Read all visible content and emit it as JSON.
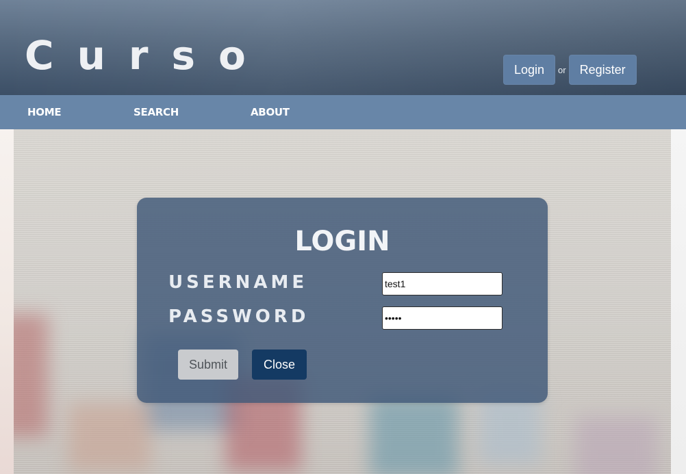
{
  "header": {
    "brand": "Curso",
    "login_label": "Login",
    "or_text": "or",
    "register_label": "Register"
  },
  "nav": {
    "items": [
      {
        "label": "HOME"
      },
      {
        "label": "SEARCH"
      },
      {
        "label": "ABOUT"
      }
    ]
  },
  "login_modal": {
    "title": "LOGIN",
    "username_label": "USERNAME",
    "username_value": "test1",
    "password_label": "PASSWORD",
    "password_value": "•••••",
    "submit_label": "Submit",
    "close_label": "Close"
  },
  "colors": {
    "header_top": "#6f8298",
    "header_bottom": "#3c4f66",
    "nav_bar": "#6886a8",
    "header_button": "#5f7ea3",
    "modal_bg": "#405878",
    "close_button": "#143a63",
    "submit_button": "#c9cbce"
  }
}
